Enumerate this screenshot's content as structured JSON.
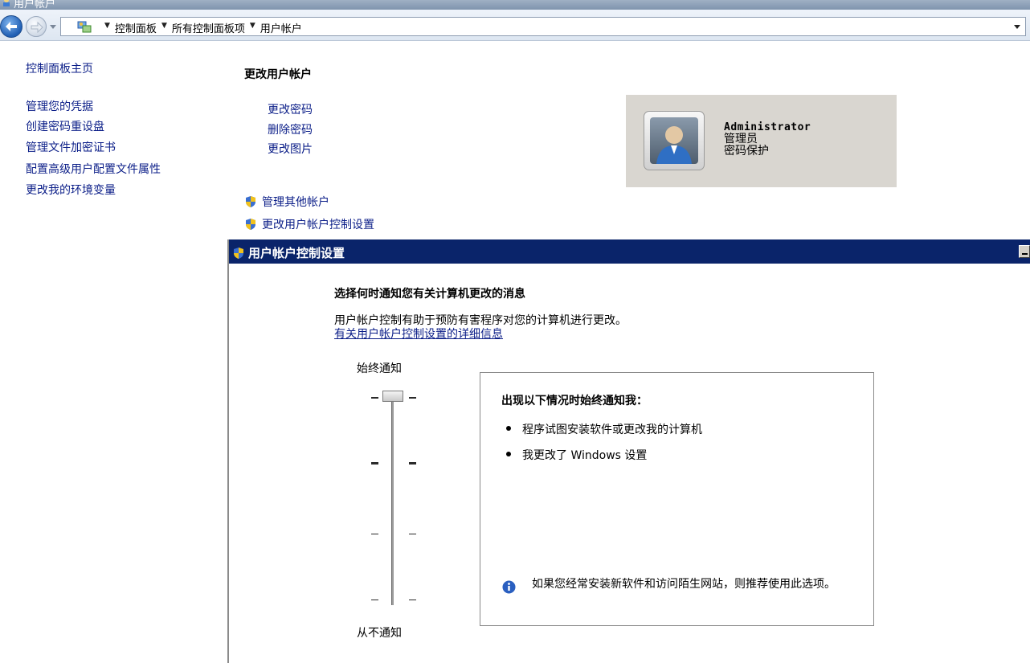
{
  "window": {
    "title": "用户帐户"
  },
  "address": {
    "crumbs": [
      "控制面板",
      "所有控制面板项",
      "用户帐户"
    ]
  },
  "sidebar": {
    "home": "控制面板主页",
    "items": [
      {
        "label": "管理您的凭据"
      },
      {
        "label": "创建密码重设盘"
      },
      {
        "label": "管理文件加密证书"
      },
      {
        "label": "配置高级用户配置文件属性"
      },
      {
        "label": "更改我的环境变量"
      }
    ]
  },
  "main": {
    "title": "更改用户帐户",
    "tasks": [
      {
        "label": "更改密码"
      },
      {
        "label": "删除密码"
      },
      {
        "label": "更改图片"
      }
    ],
    "shield_links": [
      {
        "label": "管理其他帐户"
      },
      {
        "label": "更改用户帐户控制设置"
      }
    ]
  },
  "account": {
    "name": "Administrator",
    "role": "管理员",
    "status": "密码保护"
  },
  "uac": {
    "title": "用户帐户控制设置",
    "heading": "选择何时通知您有关计算机更改的消息",
    "description": "用户帐户控制有助于预防有害程序对您的计算机进行更改。",
    "link": "有关用户帐户控制设置的详细信息",
    "slider": {
      "top_label": "始终通知",
      "bottom_label": "从不通知",
      "levels": 4,
      "selected_level": 4
    },
    "info": {
      "title": "出现以下情况时始终通知我：",
      "bullets": [
        "程序试图安装软件或更改我的计算机",
        "我更改了 Windows 设置"
      ],
      "note": "如果您经常安装新软件和访问陌生网站，则推荐使用此选项。"
    }
  },
  "colors": {
    "link": "#0b1e88",
    "uac_titlebar": "#0a246a",
    "account_panel": "#d9d6d0"
  },
  "icons": [
    "back-arrow-icon",
    "forward-arrow-icon",
    "control-panel-icon",
    "uac-shield-icon",
    "user-avatar-icon",
    "info-icon"
  ]
}
